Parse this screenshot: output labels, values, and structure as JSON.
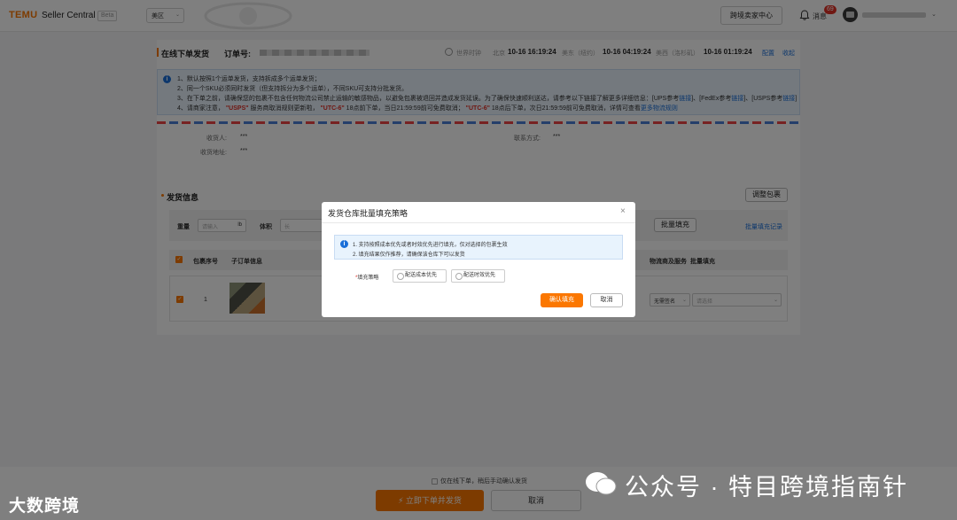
{
  "topbar": {
    "brand": "TEMU",
    "brand_sub": "Seller Central",
    "beta": "Beta",
    "region": "美区",
    "xborder_button": "跨境卖家中心",
    "messages_label": "消息",
    "messages_count": "69"
  },
  "header": {
    "page_title": "在线下单发货",
    "order_label": "订单号:",
    "world_clock_label": "世界时钟",
    "timezones": [
      {
        "label": "北京",
        "time": "10-16 16:19:24"
      },
      {
        "label": "美东（纽约）",
        "time": "10-16 04:19:24"
      },
      {
        "label": "美西（洛杉矶）",
        "time": "10-16 01:19:24"
      }
    ],
    "config_link": "配置",
    "collapse_link": "收起"
  },
  "notice": {
    "line1": "1、默认按照1个运单发货，支持拆成多个运单发货；",
    "line2": "2、同一个SKU必须同时发货（但支持拆分为多个运单），不同SKU可支持分批发货。",
    "line3": "3、在下单之前，请确保您的包裹不包含任何物流公司禁止运输的敏感物品，以避免包裹被退回并造成发货延误。为了确保快速顺利送达，请参考以下链接了解更多详细信息：[UPS参考",
    "line3_link1": "链接",
    "line3_mid": "]、[FedEx参考",
    "line3_link2": "链接",
    "line3_mid2": "]、[USPS参考",
    "line3_link3": "链接",
    "line3_end": "]",
    "line4_a": "4、请商家注意，",
    "line4_usps": "\"USPS\"",
    "line4_b": "服务商取消规则更新啦，",
    "line4_utc1": "\"UTC-6\"",
    "line4_c": "18点前下单，当日21:59:59前可免费取消；",
    "line4_utc2": "\"UTC-6\"",
    "line4_d": "18点后下单，次日21:59:59前可免费取消，详情可查看",
    "line4_link": "更多物流规则"
  },
  "receiver": {
    "name_label": "收货人:",
    "name_value": "***",
    "contact_label": "联系方式:",
    "contact_value": "***",
    "address_label": "收货地址:",
    "address_value": "***"
  },
  "shipping": {
    "title": "发货信息",
    "adjust_button": "调整包裹",
    "weight_label": "重量",
    "weight_placeholder": "请输入",
    "weight_unit": "lb",
    "volume_label": "体积",
    "volume_placeholder": "长",
    "batch_fill_button": "批量填充",
    "batch_log_link": "批量填充记录",
    "columns": [
      "包裹序号",
      "子订单信息",
      "物流商及服务",
      "批量填充"
    ],
    "rows": [
      {
        "index": "1",
        "signature": "无需签名",
        "service_placeholder": "请选择"
      }
    ]
  },
  "modal": {
    "title": "发货仓库批量填充策略",
    "tip_line1": "1. 支持按照成本优先或者时效优先进行填充，仅对选择的包裹生效",
    "tip_line2": "2. 填充结果仅作推荐，请确保该仓库下可以发货",
    "strategy_label": "填充策略",
    "option_cost": "配送成本优先",
    "option_time": "配送时效优先",
    "confirm_button": "确认填充",
    "cancel_button": "取消"
  },
  "footer": {
    "only_online_label": "仅在线下单，稍后手动确认发货",
    "ship_now_button": "立即下单并发货",
    "cancel_button": "取消"
  },
  "watermarks": {
    "left": "大数跨境",
    "right": "公众号 · 特目跨境指南针"
  },
  "colors": {
    "accent": "#fb7701",
    "link": "#1a6fd8",
    "danger": "#e02e24"
  }
}
